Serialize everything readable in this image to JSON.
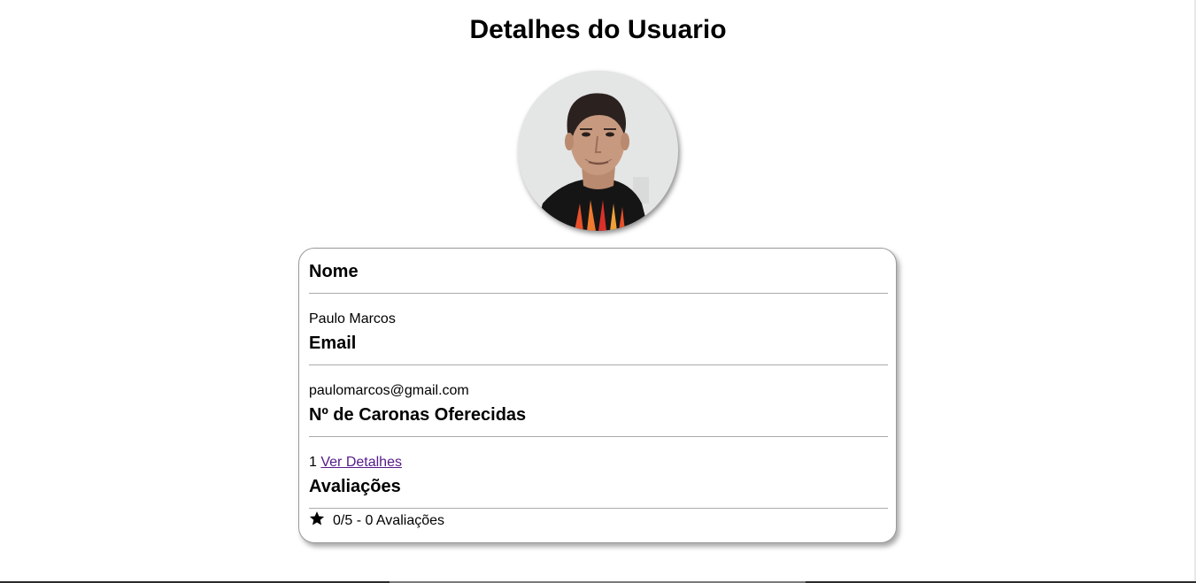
{
  "page": {
    "title": "Detalhes do Usuario"
  },
  "avatar": {
    "icon": "user-photo"
  },
  "details": {
    "name": {
      "heading": "Nome",
      "value": "Paulo Marcos"
    },
    "email": {
      "heading": "Email",
      "value": "paulomarcos@gmail.com"
    },
    "rides": {
      "heading": "Nº de Caronas Oferecidas",
      "count": "1",
      "link_label": "Ver Detalhes"
    },
    "ratings": {
      "heading": "Avaliações",
      "icon": "star-icon",
      "summary": "0/5 - 0 Avaliações"
    }
  },
  "colors": {
    "link": "#551a8b",
    "divider": "#aaaaaa",
    "card_border": "#9a9a9a"
  }
}
